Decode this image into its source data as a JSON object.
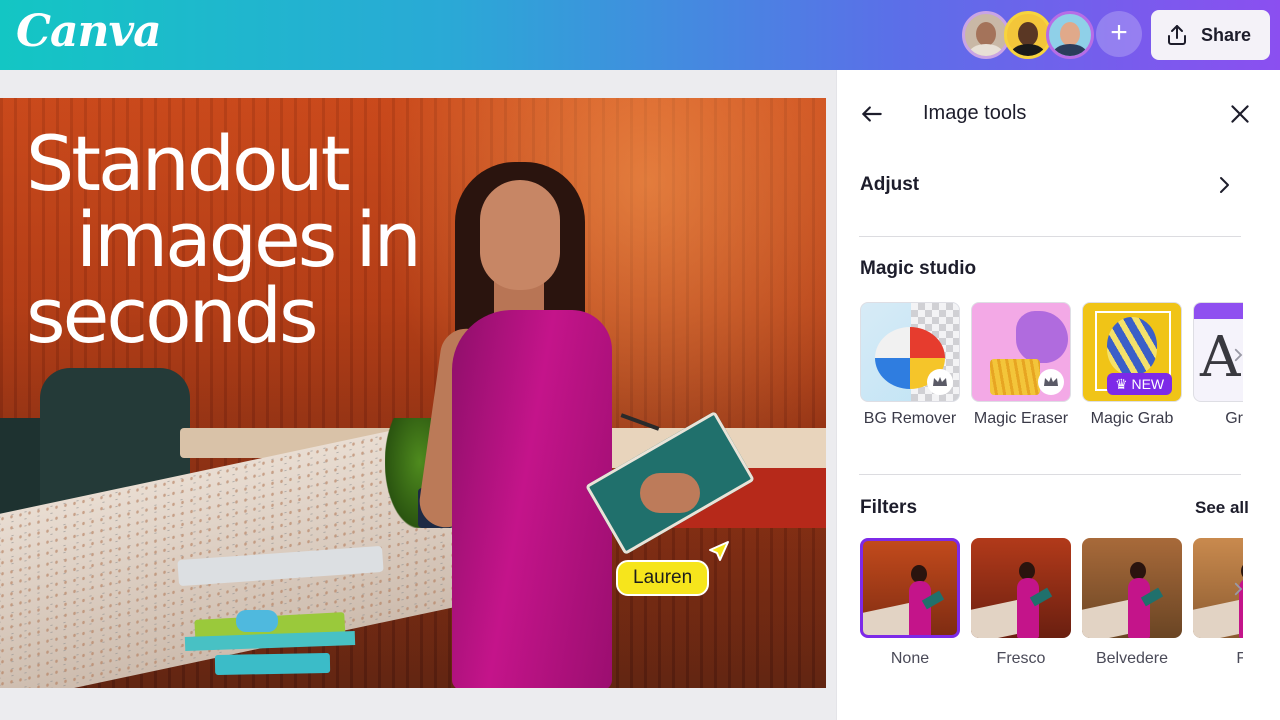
{
  "app": {
    "logo_text": "Canva",
    "share_label": "Share",
    "add_collaborator_symbol": "+"
  },
  "collaborators": [
    {
      "name": "collaborator-1",
      "ring_color": "#c9a4e6"
    },
    {
      "name": "collaborator-2",
      "ring_color": "#f7d43e"
    },
    {
      "name": "collaborator-3",
      "ring_color": "#b76de6"
    }
  ],
  "design": {
    "headline": [
      "Standout",
      "images in",
      "seconds"
    ],
    "cursor_label": "Lauren",
    "cursor_color": "#f6e51c"
  },
  "panel": {
    "title": "Image tools",
    "adjust_label": "Adjust",
    "magic_studio_title": "Magic studio",
    "tools": [
      {
        "label": "BG Remover",
        "pro": true
      },
      {
        "label": "Magic Eraser",
        "pro": true
      },
      {
        "label": "Magic Grab",
        "badge": "NEW"
      },
      {
        "label": "Grab"
      }
    ],
    "filters_title": "Filters",
    "see_all_label": "See all",
    "filters": [
      {
        "label": "None",
        "selected": true
      },
      {
        "label": "Fresco",
        "selected": false
      },
      {
        "label": "Belvedere",
        "selected": false
      },
      {
        "label": "Fi",
        "selected": false
      }
    ]
  },
  "colors": {
    "accent_purple": "#7d2ae8",
    "topbar_start": "#13c6c4",
    "topbar_end": "#8b4ff0"
  }
}
